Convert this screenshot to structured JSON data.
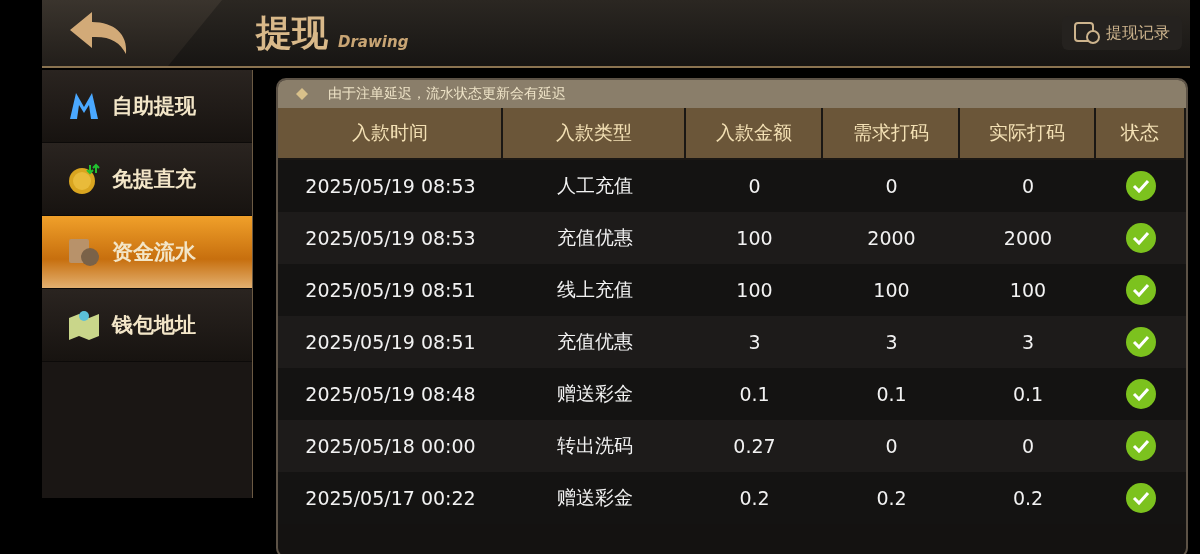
{
  "header": {
    "title": "提现",
    "subtitle": "Drawing",
    "record_button": "提现记录"
  },
  "sidebar": {
    "items": [
      {
        "label": "自助提现",
        "selected": false
      },
      {
        "label": "免提直充",
        "selected": false
      },
      {
        "label": "资金流水",
        "selected": true
      },
      {
        "label": "钱包地址",
        "selected": false
      }
    ]
  },
  "notice": "由于注单延迟，流水状态更新会有延迟",
  "table": {
    "columns": [
      "入款时间",
      "入款类型",
      "入款金额",
      "需求打码",
      "实际打码",
      "状态"
    ],
    "rows": [
      {
        "cells": [
          "2025/05/19 08:53",
          "人工充值",
          "0",
          "0",
          "0"
        ],
        "done": true
      },
      {
        "cells": [
          "2025/05/19 08:53",
          "充值优惠",
          "100",
          "2000",
          "2000"
        ],
        "done": true
      },
      {
        "cells": [
          "2025/05/19 08:51",
          "线上充值",
          "100",
          "100",
          "100"
        ],
        "done": true
      },
      {
        "cells": [
          "2025/05/19 08:51",
          "充值优惠",
          "3",
          "3",
          "3"
        ],
        "done": true
      },
      {
        "cells": [
          "2025/05/19 08:48",
          "赠送彩金",
          "0.1",
          "0.1",
          "0.1"
        ],
        "done": true
      },
      {
        "cells": [
          "2025/05/18 00:00",
          "转出洗码",
          "0.27",
          "0",
          "0"
        ],
        "done": true
      },
      {
        "cells": [
          "2025/05/17 00:22",
          "赠送彩金",
          "0.2",
          "0.2",
          "0.2"
        ],
        "done": true
      }
    ]
  }
}
